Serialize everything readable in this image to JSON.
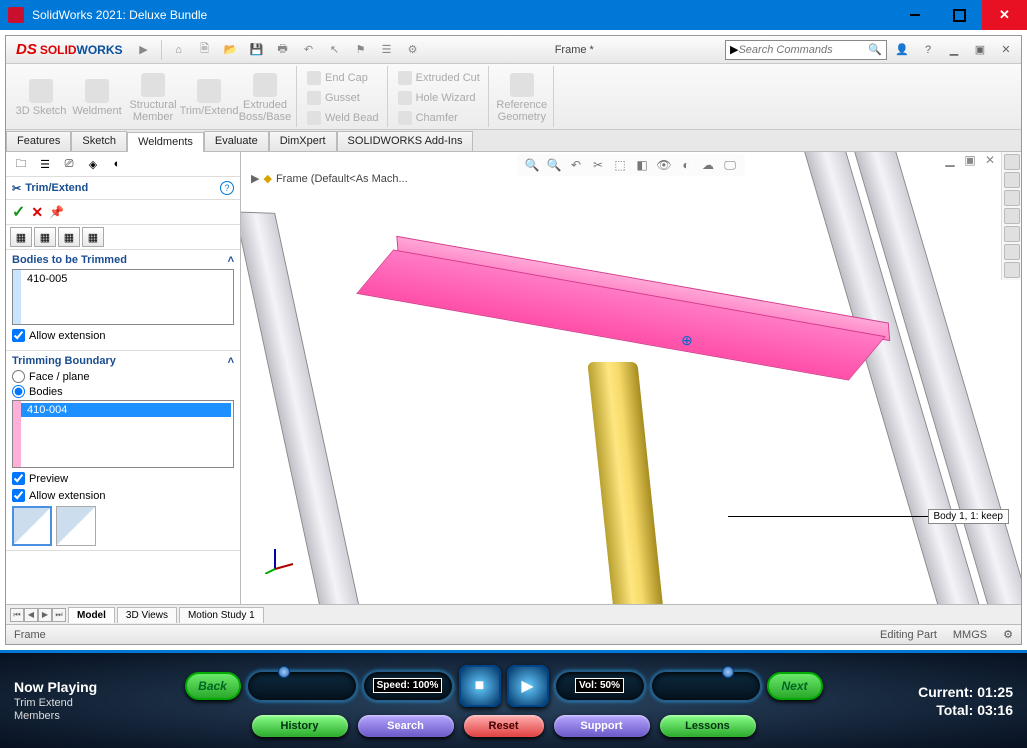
{
  "window": {
    "title": "SolidWorks 2021: Deluxe Bundle"
  },
  "app": {
    "logo_solid": "SOLID",
    "logo_works": "WORKS",
    "document": "Frame *",
    "search_placeholder": "Search Commands"
  },
  "ribbon": {
    "big": [
      "3D\nSketch",
      "Weldment",
      "Structural\nMember",
      "Trim/Extend",
      "Extruded\nBoss/Base"
    ],
    "small_col1": [
      "End Cap",
      "Gusset",
      "Weld Bead"
    ],
    "small_col2": [
      "Extruded Cut",
      "Hole Wizard",
      "Chamfer"
    ],
    "small_col3": [
      "Reference\nGeometry"
    ]
  },
  "feature_tabs": [
    "Features",
    "Sketch",
    "Weldments",
    "Evaluate",
    "DimXpert",
    "SOLIDWORKS Add-Ins"
  ],
  "active_feature_tab": "Weldments",
  "breadcrumb": "Frame  (Default<As Mach...",
  "pm": {
    "title": "Trim/Extend",
    "sec1_title": "Bodies to be Trimmed",
    "sec1_item": "410-005",
    "allow_ext1": "Allow extension",
    "sec2_title": "Trimming Boundary",
    "radio_face": "Face / plane",
    "radio_bodies": "Bodies",
    "sec2_item": "410-004",
    "preview": "Preview",
    "allow_ext2": "Allow extension"
  },
  "callout": "Body 1,  1: keep",
  "doc_tabs": [
    "Model",
    "3D Views",
    "Motion Study 1"
  ],
  "active_doc_tab": "Model",
  "status": {
    "left": "Frame",
    "mid": "Editing Part",
    "units": "MMGS"
  },
  "player": {
    "now_playing": "Now Playing",
    "subtitle": "Trim Extend\nMembers",
    "back": "Back",
    "next": "Next",
    "speed_label": "Speed: 100%",
    "vol_label": "Vol: 50%",
    "pills": [
      "History",
      "Search",
      "Reset",
      "Support",
      "Lessons"
    ],
    "current": "Current: 01:25",
    "total": "Total:    03:16"
  }
}
